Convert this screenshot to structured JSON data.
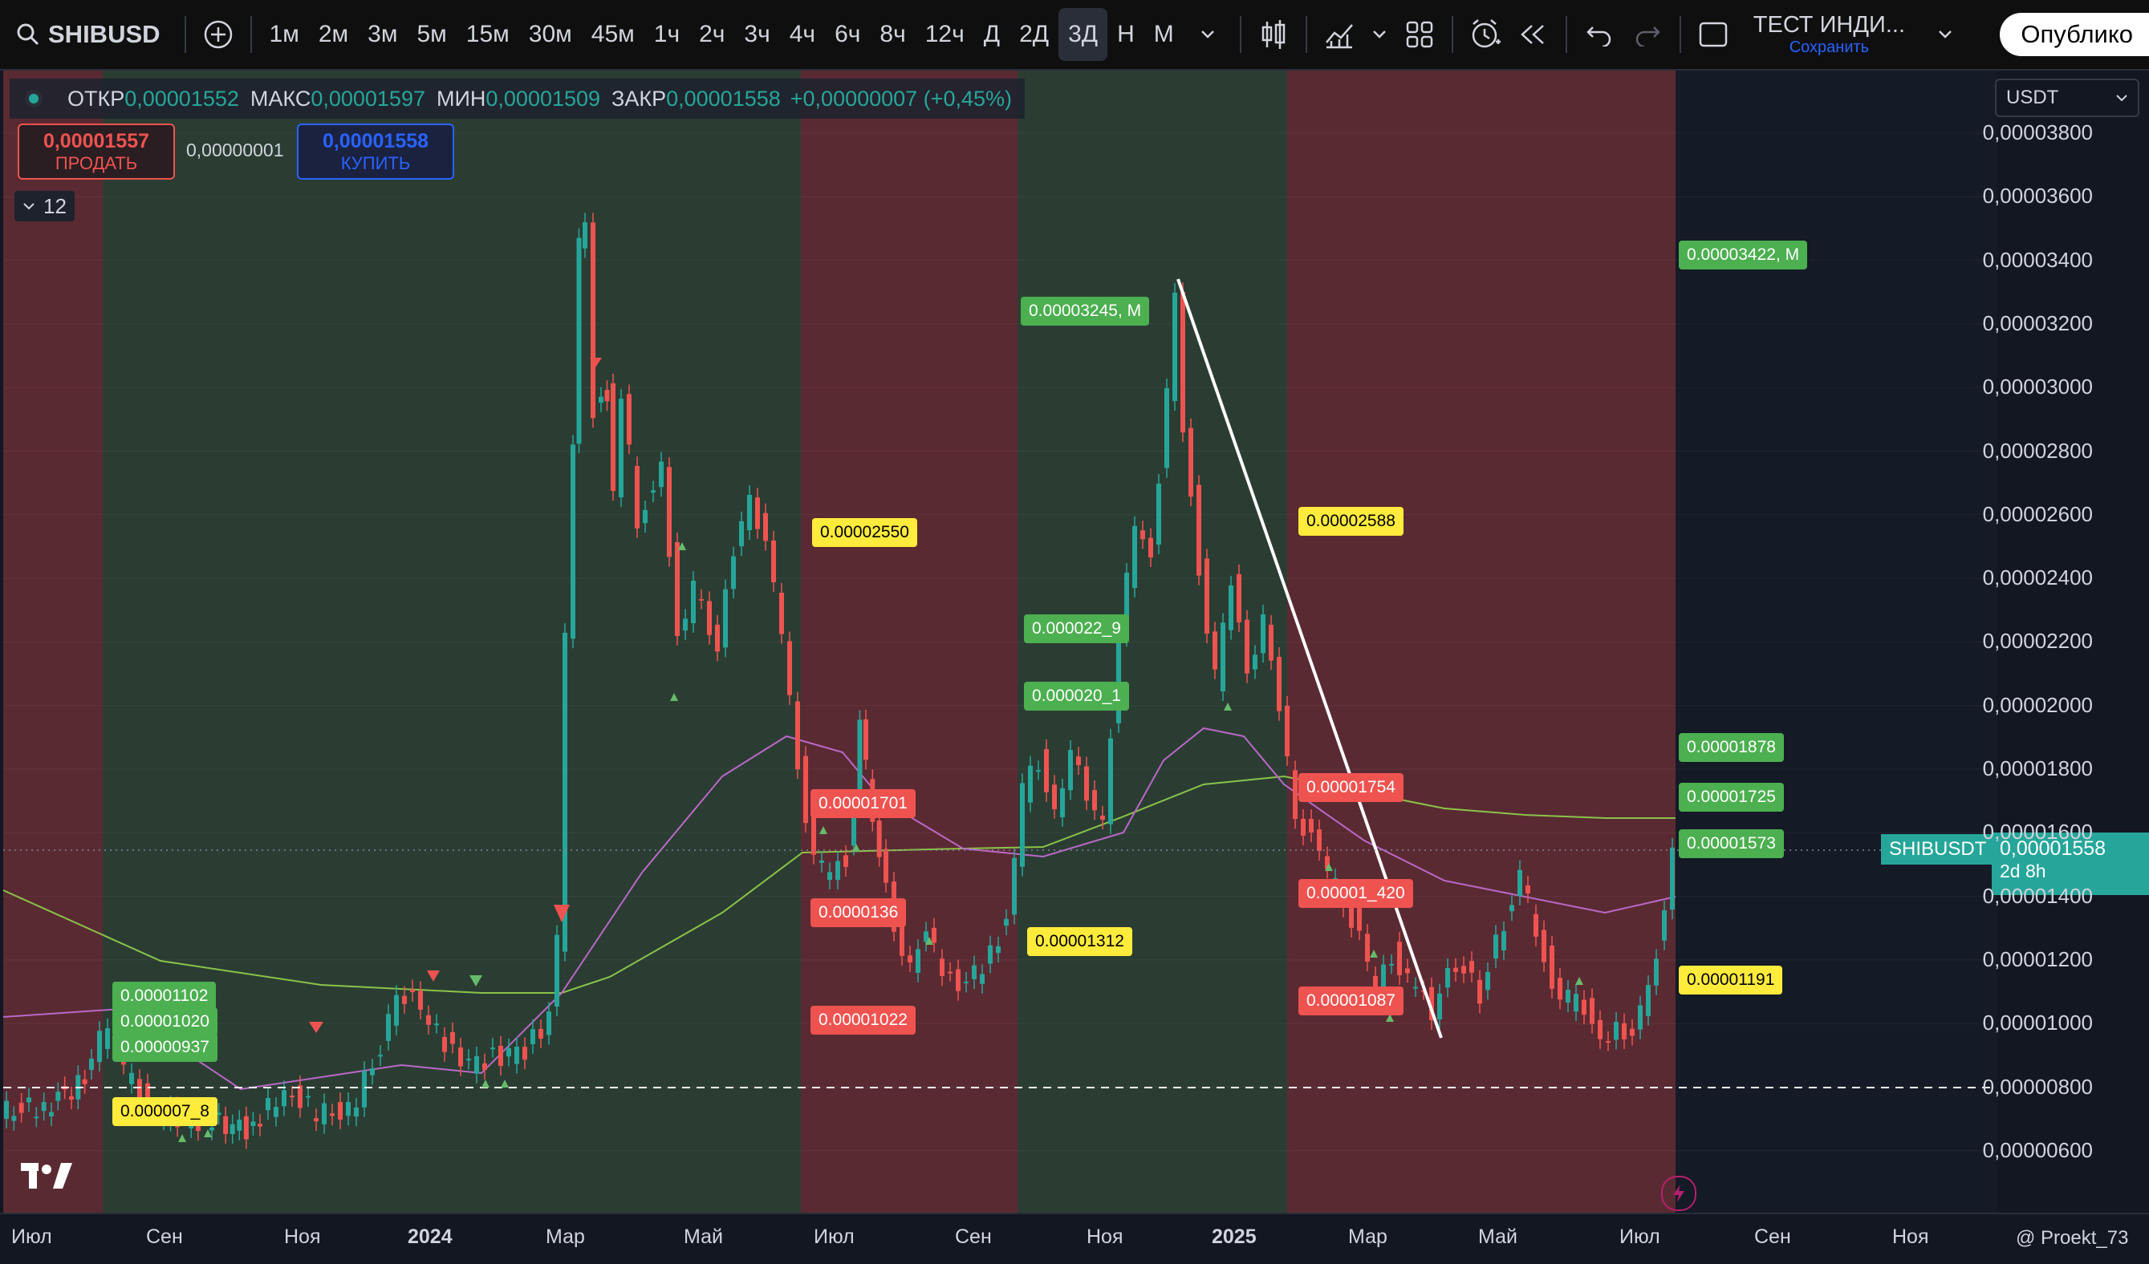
{
  "toolbar": {
    "symbol": "SHIBUSD",
    "timeframes": [
      "1м",
      "2м",
      "3м",
      "5м",
      "15м",
      "30м",
      "45м",
      "1ч",
      "2ч",
      "3ч",
      "4ч",
      "6ч",
      "8ч",
      "12ч",
      "Д",
      "2Д",
      "3Д",
      "Н",
      "М"
    ],
    "active_timeframe": "3Д",
    "layout_name": "ТЕСТ ИНДИ...",
    "layout_status": "Сохранить",
    "publish_label": "Опублико"
  },
  "legend": {
    "open_label": "ОТКР",
    "open": "0,00001552",
    "high_label": "МАКС",
    "high": "0,00001597",
    "low_label": "МИН",
    "low": "0,00001509",
    "close_label": "ЗАКР",
    "close": "0,00001558",
    "change": "+0,00000007 (+0,45%)"
  },
  "trade": {
    "sell_price": "0,00001557",
    "sell_label": "ПРОДАТЬ",
    "spread": "0,00000001",
    "buy_price": "0,00001558",
    "buy_label": "КУПИТЬ"
  },
  "indicators_count": "12",
  "currency": "USDT",
  "price_axis": [
    "0,00003800",
    "0,00003600",
    "0,00003400",
    "0,00003200",
    "0,00003000",
    "0,00002800",
    "0,00002600",
    "0,00002400",
    "0,00002200",
    "0,00002000",
    "0,00001800",
    "0,00001600",
    "0,00001400",
    "0,00001200",
    "0,00001000",
    "0,00000800",
    "0,00000600"
  ],
  "current_price": {
    "symbol": "SHIBUSDT",
    "price": "0,00001558",
    "countdown": "2d 8h"
  },
  "time_axis": [
    "Июл",
    "Сен",
    "Ноя",
    "2024",
    "Мар",
    "Май",
    "Июл",
    "Сен",
    "Ноя",
    "2025",
    "Мар",
    "Май",
    "Июл",
    "Сен",
    "Ноя"
  ],
  "chart_tags": [
    {
      "text": "0.00003422, М",
      "color": "green"
    },
    {
      "text": "0.00003245, М",
      "color": "green"
    },
    {
      "text": "0.00002550",
      "color": "yellow"
    },
    {
      "text": "0.00002588",
      "color": "yellow"
    },
    {
      "text": "0.000022_9",
      "color": "green"
    },
    {
      "text": "0.000020_1",
      "color": "green"
    },
    {
      "text": "0.00001878",
      "color": "green"
    },
    {
      "text": "0.00001725",
      "color": "green"
    },
    {
      "text": "0.00001573",
      "color": "green"
    },
    {
      "text": "0.00001754",
      "color": "red"
    },
    {
      "text": "0.00001701",
      "color": "red"
    },
    {
      "text": "0.0000136",
      "color": "red"
    },
    {
      "text": "0.00001312",
      "color": "yellow"
    },
    {
      "text": "0.00001_420",
      "color": "red"
    },
    {
      "text": "0.00001087",
      "color": "red"
    },
    {
      "text": "0.00001191",
      "color": "yellow"
    },
    {
      "text": "0.00001022",
      "color": "red"
    },
    {
      "text": "0.00001102",
      "color": "green"
    },
    {
      "text": "0.00001020",
      "color": "green"
    },
    {
      "text": "0.00000937",
      "color": "green"
    },
    {
      "text": "0.000007_8",
      "color": "yellow"
    }
  ],
  "watermark": "@ Proekt_73"
}
